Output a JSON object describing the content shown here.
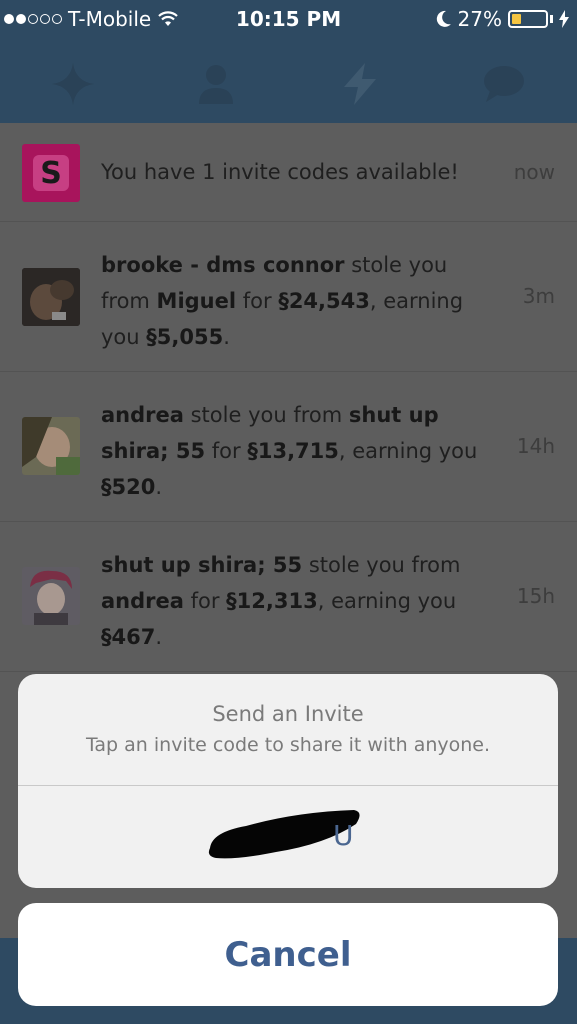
{
  "status_bar": {
    "carrier": "T-Mobile",
    "time": "10:15 PM",
    "battery": "27%",
    "battery_level": 0.27
  },
  "tabs": [
    {
      "icon": "sparkle-icon"
    },
    {
      "icon": "person-icon"
    },
    {
      "icon": "lightning-icon"
    },
    {
      "icon": "chat-bubble-icon"
    }
  ],
  "feed": {
    "invite": {
      "icon_letter": "S",
      "text": "You have 1 invite codes available!",
      "time": "now"
    },
    "items": [
      {
        "actor": "brooke - dms connor",
        "verb1": " stole you from ",
        "target": "Miguel",
        "mid": " for ",
        "amount": "§24,543",
        "earn": ", earning you ",
        "earned": "§5,055",
        "end": ".",
        "time": "3m"
      },
      {
        "actor": "andrea",
        "verb1": " stole you from ",
        "target": "shut up shira; 55",
        "mid": " for ",
        "amount": "§13,715",
        "earn": ", earning you ",
        "earned": "§520",
        "end": ".",
        "time": "14h"
      },
      {
        "actor": "shut up shira; 55",
        "verb1": " stole you from ",
        "target": "andrea",
        "mid": " for ",
        "amount": "§12,313",
        "earn": ", earning you ",
        "earned": "§467",
        "end": ".",
        "time": "15h"
      }
    ]
  },
  "sheet": {
    "title": "Send an Invite",
    "message": "Tap an invite code to share it with anyone.",
    "code_visible_suffix": "U",
    "cancel": "Cancel"
  }
}
